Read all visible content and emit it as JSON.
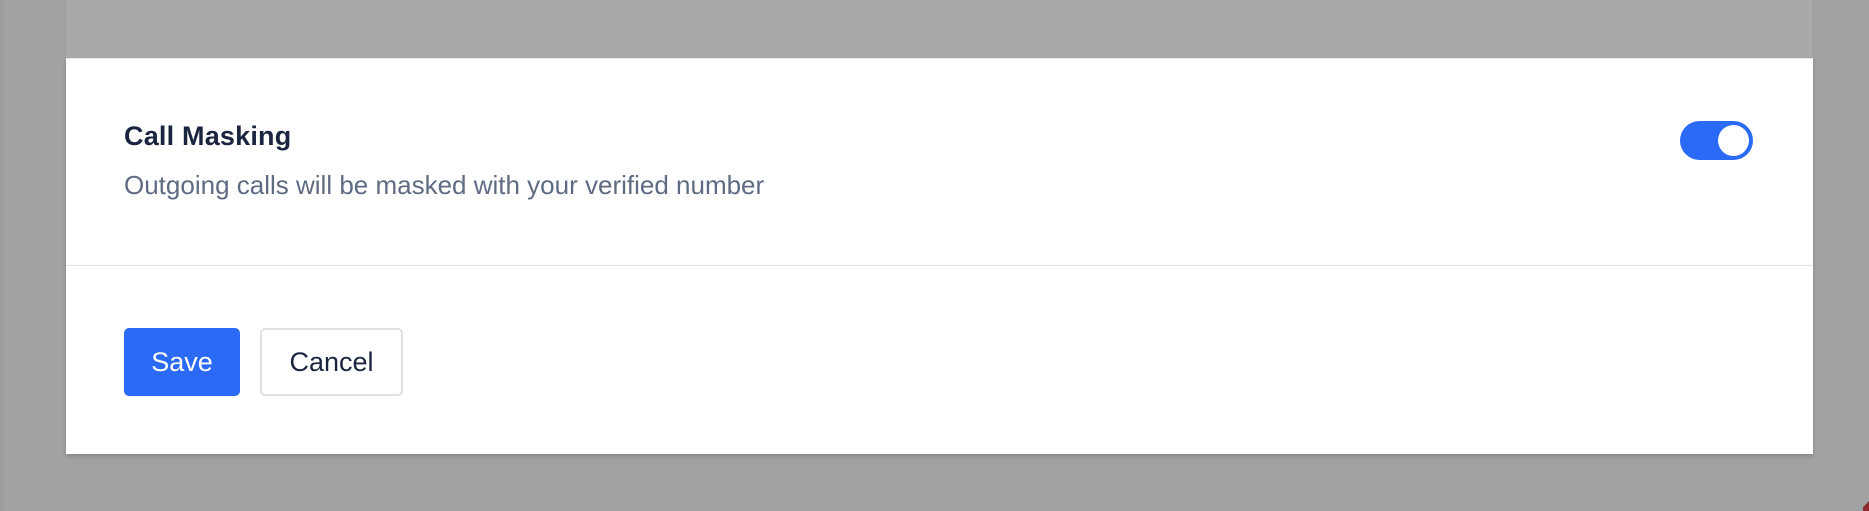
{
  "setting": {
    "title": "Call Masking",
    "description": "Outgoing calls will be masked with your verified number",
    "enabled": true
  },
  "actions": {
    "save_label": "Save",
    "cancel_label": "Cancel"
  },
  "colors": {
    "accent": "#2a6af7",
    "title_text": "#1b2540",
    "description_text": "#5f6b82",
    "overlay": "#a2a2a4"
  }
}
